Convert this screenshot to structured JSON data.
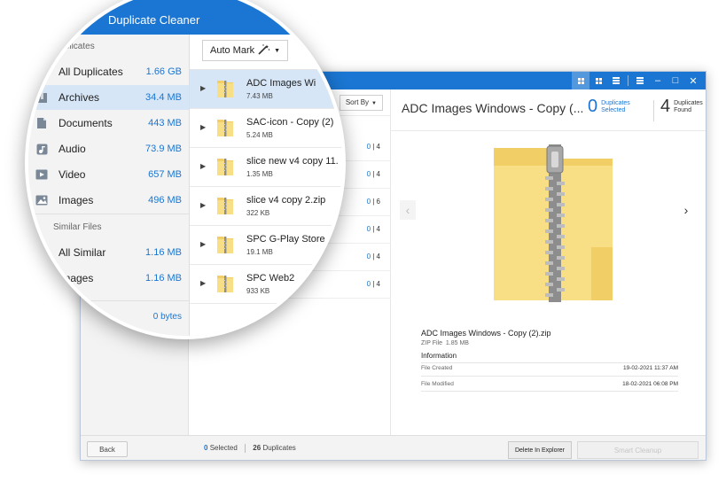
{
  "app": {
    "title": "Duplicate Cleaner"
  },
  "sidebar": {
    "sections": {
      "duplicates": "Duplicates",
      "similar": "Similar Files"
    },
    "items": [
      {
        "label": "All Duplicates",
        "size": "1.66 GB",
        "icon": "all-duplicates-icon"
      },
      {
        "label": "Archives",
        "size": "34.4 MB",
        "icon": "archive-icon"
      },
      {
        "label": "Documents",
        "size": "443 MB",
        "icon": "document-icon"
      },
      {
        "label": "Audio",
        "size": "73.9 MB",
        "icon": "music-note-icon"
      },
      {
        "label": "Video",
        "size": "657 MB",
        "icon": "video-icon"
      },
      {
        "label": "Images",
        "size": "496 MB",
        "icon": "image-icon"
      }
    ],
    "similar_items": [
      {
        "label": "All Similar",
        "size": "1.16 MB",
        "icon": "all-similar-icon"
      },
      {
        "label": "Images",
        "size": "1.16 MB",
        "icon": "image-icon"
      }
    ],
    "footer_size": "0 bytes"
  },
  "toolbar": {
    "auto_mark": "Auto Mark",
    "sort_by": "Sort By"
  },
  "files": [
    {
      "name": "ADC Images Windows - Copy (2).zip",
      "display_name": "ADC Images Wi",
      "size": "7.43 MB",
      "selected_count": "0",
      "total_count": "4"
    },
    {
      "name": "SAC-icon - Copy (2)",
      "display_name": "SAC-icon - Copy (2)",
      "size": "5.24 MB",
      "selected_count": "0",
      "total_count": "4"
    },
    {
      "name": "slice new v4 copy 11.",
      "display_name": "slice new v4 copy 11.",
      "size": "1.35 MB",
      "selected_count": "0",
      "total_count": "6"
    },
    {
      "name": "slice v4 copy 2.zip",
      "display_name": "slice v4 copy 2.zip",
      "size": "322 KB",
      "selected_count": "0",
      "total_count": "4"
    },
    {
      "name": "SPC G-Play Store",
      "display_name": "SPC G-Play Store",
      "size": "19.1 MB",
      "selected_count": "0",
      "total_count": "4"
    },
    {
      "name": "SPC Web2",
      "display_name": "SPC Web2",
      "size": "933 KB",
      "selected_count": "0",
      "total_count": "4"
    }
  ],
  "detail": {
    "title": "ADC Images Windows - Copy (...",
    "duplicates_selected_num": "0",
    "duplicates_selected_label": "Duplicates Selected",
    "duplicates_found_num": "4",
    "duplicates_found_label": "Duplicates Found",
    "file_name": "ADC Images Windows - Copy (2).zip",
    "file_type": "ZIP File",
    "file_size": "1.85 MB",
    "info_heading": "Information",
    "created_label": "File Created",
    "created_value": "19-02-2021 11:37 AM",
    "modified_label": "File Modified",
    "modified_value": "18-02-2021 06:08 PM"
  },
  "bottom": {
    "back": "Back",
    "selected_num": "0",
    "selected_label": "Selected",
    "duplicates_num": "26",
    "duplicates_label": "Duplicates",
    "delete_in_explorer": "Delete In Explorer",
    "smart_cleanup": "Smart Cleanup"
  },
  "colors": {
    "accent": "#1a76d2",
    "selection": "#d6e6f6",
    "folder": "#f6d774"
  }
}
